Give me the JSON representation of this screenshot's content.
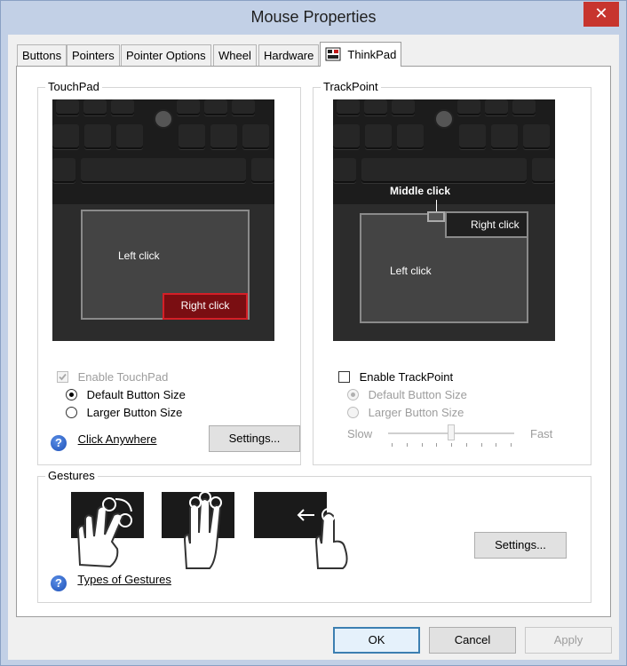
{
  "window": {
    "title": "Mouse Properties",
    "close_glyph": "✕"
  },
  "tabs": [
    {
      "label": "Buttons"
    },
    {
      "label": "Pointers"
    },
    {
      "label": "Pointer Options"
    },
    {
      "label": "Wheel"
    },
    {
      "label": "Hardware"
    },
    {
      "label": "ThinkPad",
      "icon": "thinkpad-icon",
      "active": true
    }
  ],
  "touchpad": {
    "group_label": "TouchPad",
    "image": {
      "left_click": "Left click",
      "right_click": "Right click"
    },
    "enable_label": "Enable TouchPad",
    "enable_checked": true,
    "enable_disabled": true,
    "default_size_label": "Default Button Size",
    "larger_size_label": "Larger Button Size",
    "selected_size": "default",
    "help_link": "Click Anywhere",
    "settings_button": "Settings..."
  },
  "trackpoint": {
    "group_label": "TrackPoint",
    "image": {
      "middle_click": "Middle click",
      "right_click": "Right click",
      "left_click": "Left click"
    },
    "enable_label": "Enable TrackPoint",
    "enable_checked": false,
    "default_size_label": "Default Button Size",
    "larger_size_label": "Larger Button Size",
    "selected_size": "default",
    "speed": {
      "slow_label": "Slow",
      "fast_label": "Fast",
      "value_fraction": 0.5
    }
  },
  "gestures": {
    "group_label": "Gestures",
    "help_link": "Types of Gestures",
    "settings_button": "Settings...",
    "icons": [
      "two-finger-rotate-icon",
      "three-finger-swipe-icon",
      "one-finger-swipe-icon"
    ]
  },
  "footer": {
    "ok": "OK",
    "cancel": "Cancel",
    "apply": "Apply"
  },
  "colors": {
    "frame": "#c2d0e6",
    "close": "#c7352e",
    "right_click_zone": "#d41f27"
  }
}
